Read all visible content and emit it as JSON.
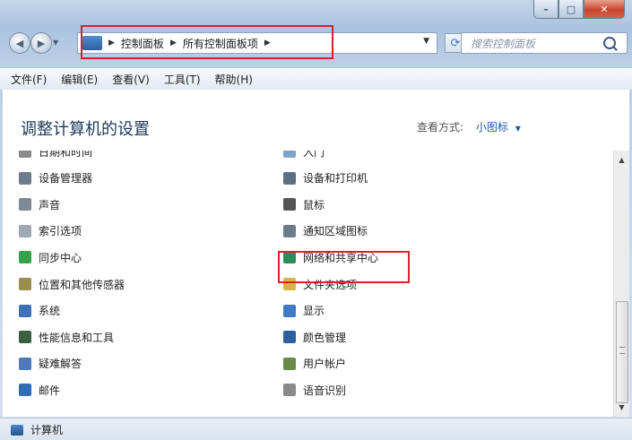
{
  "window": {
    "caption": {
      "minimize": "–",
      "maximize": "□",
      "close": "✕"
    }
  },
  "nav": {
    "back_icon": "◀",
    "forward_icon": "▶",
    "breadcrumbs": [
      "控制面板",
      "所有控制面板项"
    ],
    "search_placeholder": "搜索控制面板"
  },
  "menu": [
    "文件(F)",
    "编辑(E)",
    "查看(V)",
    "工具(T)",
    "帮助(H)"
  ],
  "content": {
    "title": "调整计算机的设置",
    "view_by_label": "查看方式:",
    "view_by_value": "小图标"
  },
  "items_left": [
    {
      "label": "日期和时间",
      "icon": "clock-icon",
      "color": "#8a8a8a"
    },
    {
      "label": "设备管理器",
      "icon": "device-manager-icon",
      "color": "#6e7b8c"
    },
    {
      "label": "声音",
      "icon": "speaker-icon",
      "color": "#7f8897"
    },
    {
      "label": "索引选项",
      "icon": "indexing-icon",
      "color": "#a0a8b4"
    },
    {
      "label": "同步中心",
      "icon": "sync-icon",
      "color": "#34a24a"
    },
    {
      "label": "位置和其他传感器",
      "icon": "sensor-icon",
      "color": "#9a8e4c"
    },
    {
      "label": "系统",
      "icon": "system-icon",
      "color": "#3f6fb5"
    },
    {
      "label": "性能信息和工具",
      "icon": "performance-icon",
      "color": "#3b5f3f"
    },
    {
      "label": "疑难解答",
      "icon": "troubleshoot-icon",
      "color": "#4f79b8"
    },
    {
      "label": "邮件",
      "icon": "mail-icon",
      "color": "#2f6db5"
    }
  ],
  "items_right": [
    {
      "label": "入门",
      "icon": "getting-started-icon",
      "color": "#7ea4cc"
    },
    {
      "label": "设备和打印机",
      "icon": "printer-icon",
      "color": "#5b6f86"
    },
    {
      "label": "鼠标",
      "icon": "mouse-icon",
      "color": "#555555"
    },
    {
      "label": "通知区域图标",
      "icon": "notification-icon",
      "color": "#6b7b8c"
    },
    {
      "label": "网络和共享中心",
      "icon": "network-icon",
      "color": "#2c8c5a"
    },
    {
      "label": "文件夹选项",
      "icon": "folder-icon",
      "color": "#d9b24a"
    },
    {
      "label": "显示",
      "icon": "display-icon",
      "color": "#3f7bc2"
    },
    {
      "label": "颜色管理",
      "icon": "color-management-icon",
      "color": "#2f5f9e"
    },
    {
      "label": "用户帐户",
      "icon": "user-accounts-icon",
      "color": "#6a8a4a"
    },
    {
      "label": "语音识别",
      "icon": "microphone-icon",
      "color": "#8a8a8a"
    }
  ],
  "status": {
    "label": "计算机"
  }
}
